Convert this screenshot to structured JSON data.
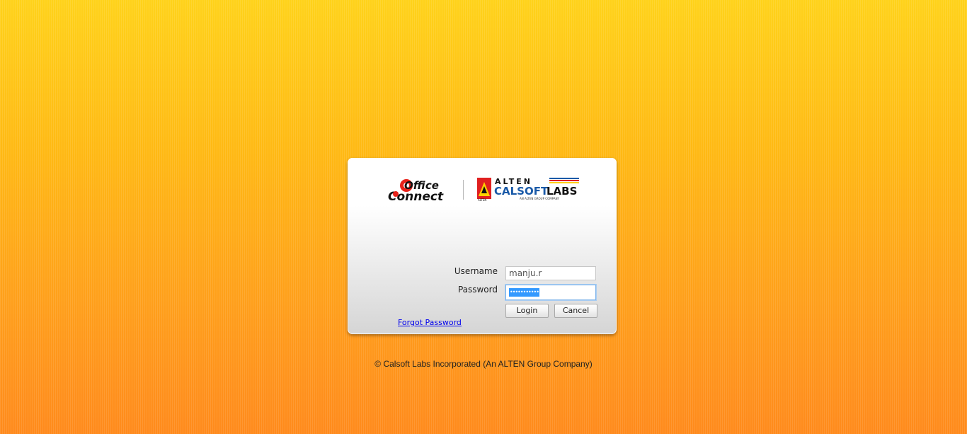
{
  "logos": {
    "office_connect": {
      "line1": "Office",
      "line2": "Connect"
    },
    "alten": {
      "top": "ALTEN",
      "main_a": "CALSOFT",
      "main_b": "LABS",
      "tag": "AN ALTEN GROUP COMPANY",
      "mark_text": "ALTEN"
    }
  },
  "form": {
    "username_label": "Username",
    "username_value": "manju.r",
    "password_label": "Password",
    "password_mask": "•••••••••••",
    "login_label": "Login",
    "cancel_label": "Cancel",
    "forgot_label": "Forgot Password"
  },
  "footer": {
    "copyright": "© Calsoft Labs Incorporated (An ALTEN Group Company)"
  },
  "colors": {
    "bg_top": "#ffd21a",
    "bg_bottom": "#ff8a1c",
    "link": "#0000ee",
    "selection": "#3399ff",
    "alten_blue": "#1a5aa8",
    "alten_red": "#e02020",
    "alten_yellow": "#ffd200"
  }
}
